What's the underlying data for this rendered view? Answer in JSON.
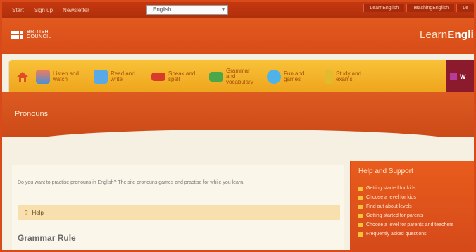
{
  "topbar": {
    "links": [
      "Start",
      "Sign up",
      "Newsletter"
    ],
    "language_select": "English",
    "right_links": [
      "LearnEnglish",
      "TeachingEnglish",
      "Le"
    ]
  },
  "header": {
    "logo_line1": "BRITISH",
    "logo_line2": "COUNCIL",
    "site_name_prefix": "Learn",
    "site_name_bold": "Engli"
  },
  "nav": {
    "items": [
      {
        "label": "Listen and watch",
        "icon": "headphones-person-icon",
        "color": "#4a8fd6"
      },
      {
        "label": "Read and write",
        "icon": "book-icon",
        "color": "#58a9e6"
      },
      {
        "label": "Speak and spell",
        "icon": "abc-icon",
        "color": "#d93a2a"
      },
      {
        "label": "Grammar and vocabulary",
        "icon": "grammar-icon",
        "color": "#4aa84b"
      },
      {
        "label": "Fun and games",
        "icon": "games-icon",
        "color": "#4fb2e8"
      },
      {
        "label": "Study and exams",
        "icon": "exam-icon",
        "color": "#e1bb2d"
      }
    ],
    "tail_label": "W"
  },
  "banner": {
    "title": "Pronouns"
  },
  "main": {
    "intro_text": "Do you want to practise pronouns in English? The site pronouns games and practise for while you learn.",
    "help_prefix": "?",
    "help_label": "Help",
    "section_title": "Grammar Rule"
  },
  "sidebar": {
    "title": "Help and Support",
    "items": [
      "Getting started for kids",
      "Choose a level for kids",
      "Find out about levels",
      "Getting started for parents",
      "Choose a level for parents and teachers",
      "Frequently asked questions"
    ]
  }
}
